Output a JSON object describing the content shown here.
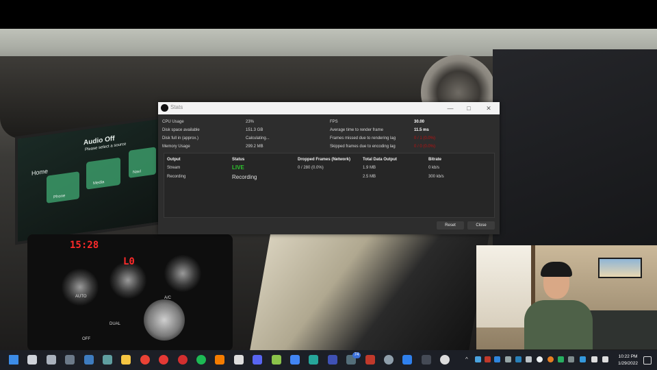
{
  "window": {
    "title": "Stats",
    "minimize": "—",
    "maximize": "□",
    "close": "✕"
  },
  "metrics_left": [
    {
      "label": "CPU Usage",
      "value": "23%"
    },
    {
      "label": "Disk space available",
      "value": "151.3 GB"
    },
    {
      "label": "Disk full in (approx.)",
      "value": "Calculating..."
    },
    {
      "label": "Memory Usage",
      "value": "299.2 MB"
    }
  ],
  "metrics_right": [
    {
      "label": "FPS",
      "value": "30.00"
    },
    {
      "label": "Average time to render frame",
      "value": "11.5 ms"
    },
    {
      "label": "Frames missed due to rendering lag",
      "value": "0 / 1 (0.0%)"
    },
    {
      "label": "Skipped frames due to encoding lag",
      "value": "0 / 0 (0.0%)"
    }
  ],
  "table": {
    "headers": [
      "Output",
      "Status",
      "Dropped Frames (Network)",
      "Total Data Output",
      "Bitrate"
    ],
    "rows": [
      {
        "output": "Stream",
        "status": "LIVE",
        "dropped": "0 / 280 (0.0%)",
        "total": "1.9 MB",
        "bitrate": "0 kb/s"
      },
      {
        "output": "Recording",
        "status": "Recording",
        "dropped": "",
        "total": "2.5 MB",
        "bitrate": "300 kb/s"
      }
    ]
  },
  "buttons": {
    "reset": "Reset",
    "close": "Close"
  },
  "background": {
    "screen": {
      "title": "Audio Off",
      "subtitle": "Please select a source",
      "home": "Home",
      "phone": "Phone",
      "media": "Media",
      "navi": "Navi"
    },
    "clock_readout": "15:28",
    "fan_readout": "L0",
    "knob_auto": "AUTO",
    "btn_ac": "A/C",
    "btn_dual": "DUAL",
    "btn_off": "OFF"
  },
  "taskbar": {
    "icons": [
      "windows-start-icon",
      "search-icon",
      "task-view-icon",
      "settings-icon",
      "photos-icon",
      "remote-desktop-icon",
      "file-explorer-icon",
      "chrome-icon",
      "opera-gx-icon",
      "opera-icon",
      "spotify-icon",
      "vlc-icon",
      "dots-app-icon",
      "discord-icon",
      "app-stack-icon",
      "shield-icon",
      "cube-icon",
      "browser-icon",
      "badge-app-icon",
      "store-icon",
      "globe-icon",
      "virtualbox-icon",
      "terminal-icon",
      "obs-icon"
    ],
    "badge": "74",
    "time": "10:22 PM",
    "date": "1/29/2022"
  },
  "colors": {
    "live": "#2ec52e",
    "error": "#c01010",
    "dialog_bg": "#2d2d2d",
    "taskbar_bg": "#1c1f26"
  }
}
